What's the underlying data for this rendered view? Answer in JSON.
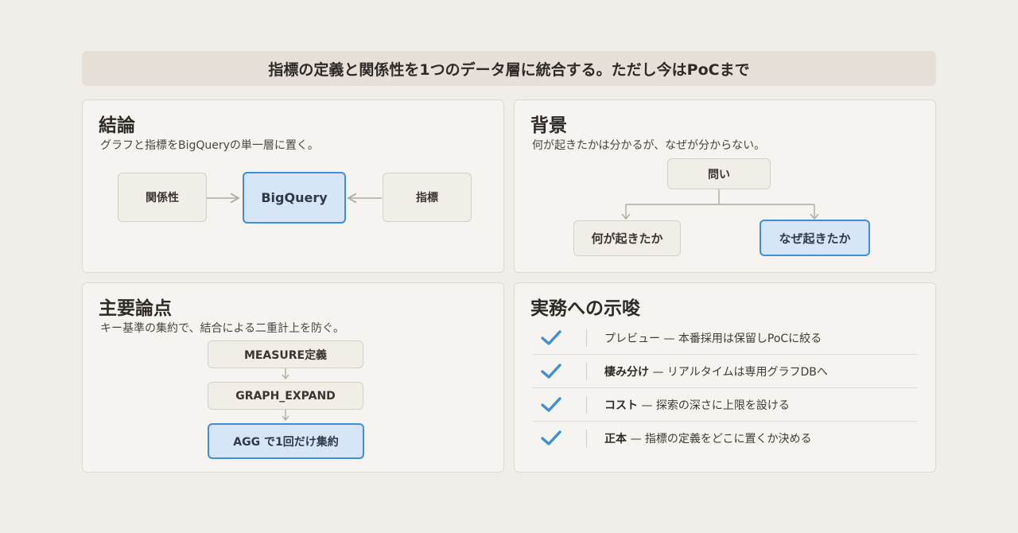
{
  "banner": "指標の定義と関係性を1つのデータ層に統合する。ただし今はPoCまで",
  "conclusion": {
    "title": "結論",
    "subtitle": "グラフと指標をBigQueryの単一層に置く。",
    "left_box": "関係性",
    "center_box": "BigQuery",
    "right_box": "指標"
  },
  "background": {
    "title": "背景",
    "subtitle": "何が起きたかは分かるが、なぜが分からない。",
    "root": "問い",
    "left_leaf": "何が起きたか",
    "right_leaf": "なぜ起きたか"
  },
  "points": {
    "title": "主要論点",
    "subtitle": "キー基準の集約で、結合による二重計上を防ぐ。",
    "steps": [
      "MEASURE定義",
      "GRAPH_EXPAND",
      "AGG で1回だけ集約"
    ]
  },
  "implications": {
    "title": "実務への示唆",
    "items": [
      {
        "bold": "",
        "text": "プレビュー — 本番採用は保留しPoCに絞る"
      },
      {
        "bold": "棲み分け",
        "text": " — リアルタイムは専用グラフDBへ"
      },
      {
        "bold": "コスト",
        "text": " — 探索の深さに上限を設ける"
      },
      {
        "bold": "正本",
        "text": " — 指標の定義をどこに置くか決める"
      }
    ],
    "check_icon": "check-icon",
    "check_color": "#3f8ed6"
  },
  "colors": {
    "highlight_border": "#3f8ed6",
    "highlight_fill": "#d6e6f7",
    "background": "#f1eee9"
  }
}
